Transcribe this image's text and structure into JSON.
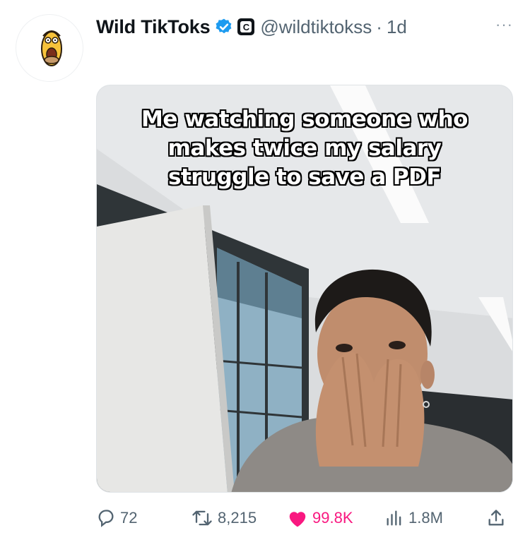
{
  "tweet": {
    "display_name": "Wild TikToks",
    "handle": "@wildtiktokss",
    "separator": "·",
    "time": "1d",
    "more": "···",
    "org_badge_letter": "C",
    "verified": true,
    "media_caption": "Me watching someone who makes twice my salary struggle to save a PDF"
  },
  "actions": {
    "replies": "72",
    "reposts": "8,215",
    "likes": "99.8K",
    "views": "1.8M"
  },
  "colors": {
    "verified_blue": "#1d9bf0",
    "like_pink": "#f91880",
    "muted_text": "#536471"
  },
  "icons": [
    "avatar-cartoon",
    "verified-badge-icon",
    "org-badge-icon",
    "more-icon",
    "reply-icon",
    "repost-icon",
    "like-icon",
    "views-icon",
    "share-icon"
  ]
}
